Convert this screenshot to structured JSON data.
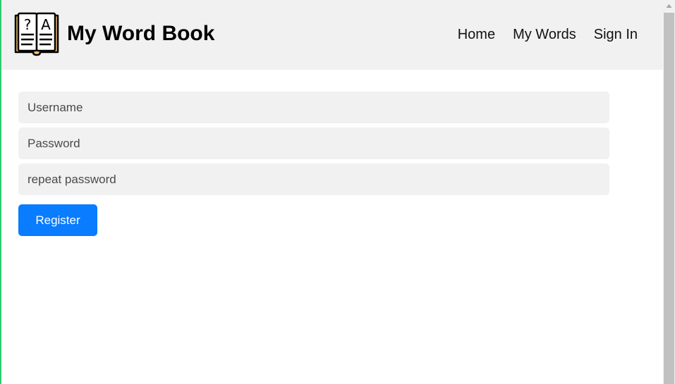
{
  "header": {
    "title": "My Word Book",
    "logo_icon": "open-book-icon",
    "logo_glyphs": [
      "?",
      "A"
    ],
    "nav": [
      {
        "label": "Home"
      },
      {
        "label": "My Words"
      },
      {
        "label": "Sign In"
      }
    ]
  },
  "form": {
    "username": {
      "placeholder": "Username",
      "value": ""
    },
    "password": {
      "placeholder": "Password",
      "value": ""
    },
    "repeat_password": {
      "placeholder": "repeat password",
      "value": ""
    },
    "register_label": "Register"
  },
  "colors": {
    "header_bg": "#f1f1f1",
    "input_bg": "#f1f1f1",
    "button_bg": "#0a7cff",
    "button_text": "#ffffff",
    "left_edge": "#2ecc71",
    "logo_cover": "#f0c27b"
  }
}
